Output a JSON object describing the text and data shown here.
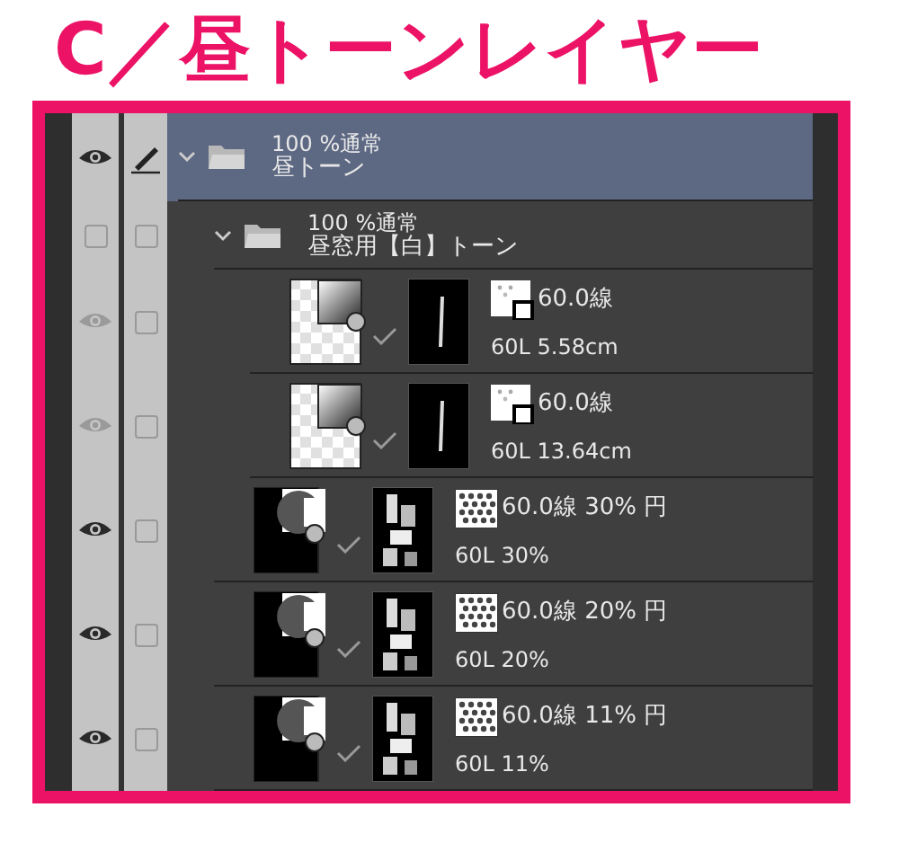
{
  "title": "C／昼トーンレイヤー",
  "layers": [
    {
      "kind": "folder",
      "visible": true,
      "editing": true,
      "selected": true,
      "expanded": true,
      "blend": "100 %通常",
      "name": "昼トーン",
      "children": [
        {
          "kind": "folder",
          "visible": false,
          "editing": false,
          "selected": false,
          "expanded": true,
          "blend": "100 %通常",
          "name": "昼窓用【白】トーン",
          "children": [
            {
              "kind": "gradation",
              "visible": true,
              "dimmed": true,
              "editing": false,
              "selected": false,
              "setting": "60.0線",
              "detail": "60L 5.58cm"
            },
            {
              "kind": "gradation",
              "visible": true,
              "dimmed": true,
              "editing": false,
              "selected": false,
              "setting": "60.0線",
              "detail": "60L 13.64cm"
            }
          ]
        },
        {
          "kind": "dot",
          "visible": true,
          "dimmed": false,
          "editing": false,
          "selected": false,
          "setting": "60.0線 30% 円",
          "detail": "60L 30%"
        },
        {
          "kind": "dot",
          "visible": true,
          "dimmed": false,
          "editing": false,
          "selected": false,
          "setting": "60.0線 20% 円",
          "detail": "60L 20%"
        },
        {
          "kind": "dot",
          "visible": true,
          "dimmed": false,
          "editing": false,
          "selected": false,
          "setting": "60.0線 11% 円",
          "detail": "60L 11%"
        }
      ]
    }
  ]
}
